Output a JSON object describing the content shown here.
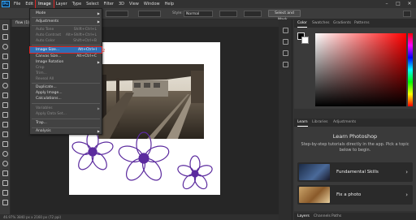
{
  "app": {
    "logo": "Ps"
  },
  "menubar": {
    "items": [
      "File",
      "Edit",
      "Image",
      "Layer",
      "Type",
      "Select",
      "Filter",
      "3D",
      "View",
      "Window",
      "Help"
    ]
  },
  "options": {
    "style_label": "Style:",
    "style_value": "Normal",
    "select_mask_label": "Select and Mask...",
    "win_controls": [
      "–",
      "□",
      "✕"
    ]
  },
  "document": {
    "tab_label": "flow (1)-Ca",
    "status": "46.97%   3840 px x 2160 px (72 ppi)"
  },
  "image_menu": {
    "items": [
      {
        "label": "Mode",
        "shortcut": "",
        "submenu": true,
        "disabled": false
      },
      {
        "label": "Adjustments",
        "shortcut": "",
        "submenu": true,
        "disabled": false
      },
      {
        "label": "Auto Tone",
        "shortcut": "Shift+Ctrl+L",
        "submenu": false,
        "disabled": true
      },
      {
        "label": "Auto Contrast",
        "shortcut": "Alt+Shift+Ctrl+L",
        "submenu": false,
        "disabled": true
      },
      {
        "label": "Auto Color",
        "shortcut": "Shift+Ctrl+B",
        "submenu": false,
        "disabled": true
      },
      {
        "label": "Image Size...",
        "shortcut": "Alt+Ctrl+I",
        "submenu": false,
        "disabled": false,
        "highlight": true
      },
      {
        "label": "Canvas Size...",
        "shortcut": "Alt+Ctrl+C",
        "submenu": false,
        "disabled": false
      },
      {
        "label": "Image Rotation",
        "shortcut": "",
        "submenu": true,
        "disabled": false
      },
      {
        "label": "Crop",
        "shortcut": "",
        "submenu": false,
        "disabled": true
      },
      {
        "label": "Trim...",
        "shortcut": "",
        "submenu": false,
        "disabled": true
      },
      {
        "label": "Reveal All",
        "shortcut": "",
        "submenu": false,
        "disabled": true
      },
      {
        "label": "Duplicate...",
        "shortcut": "",
        "submenu": false,
        "disabled": false
      },
      {
        "label": "Apply Image...",
        "shortcut": "",
        "submenu": false,
        "disabled": false
      },
      {
        "label": "Calculations...",
        "shortcut": "",
        "submenu": false,
        "disabled": false
      },
      {
        "label": "Variables",
        "shortcut": "",
        "submenu": true,
        "disabled": true
      },
      {
        "label": "Apply Data Set...",
        "shortcut": "",
        "submenu": false,
        "disabled": true
      },
      {
        "label": "Trap...",
        "shortcut": "",
        "submenu": false,
        "disabled": false
      },
      {
        "label": "Analysis",
        "shortcut": "",
        "submenu": true,
        "disabled": false
      }
    ],
    "annotation": "2"
  },
  "color_panel": {
    "tabs": [
      "Color",
      "Swatches",
      "Gradients",
      "Patterns"
    ]
  },
  "learn_panel": {
    "tabs": [
      "Learn",
      "Libraries",
      "Adjustments"
    ],
    "title": "Learn Photoshop",
    "description": "Step-by-step tutorials directly in the app. Pick a topic below to begin.",
    "cards": [
      {
        "label": "Fundamental Skills"
      },
      {
        "label": "Fix a photo"
      }
    ]
  },
  "layers_panel": {
    "tabs": [
      "Layers",
      "Channels",
      "Paths"
    ]
  },
  "colors": {
    "menu_highlight": "#2d6fb5",
    "annotation_red": "#e02424",
    "flower_purple": "#5b2a9e"
  }
}
